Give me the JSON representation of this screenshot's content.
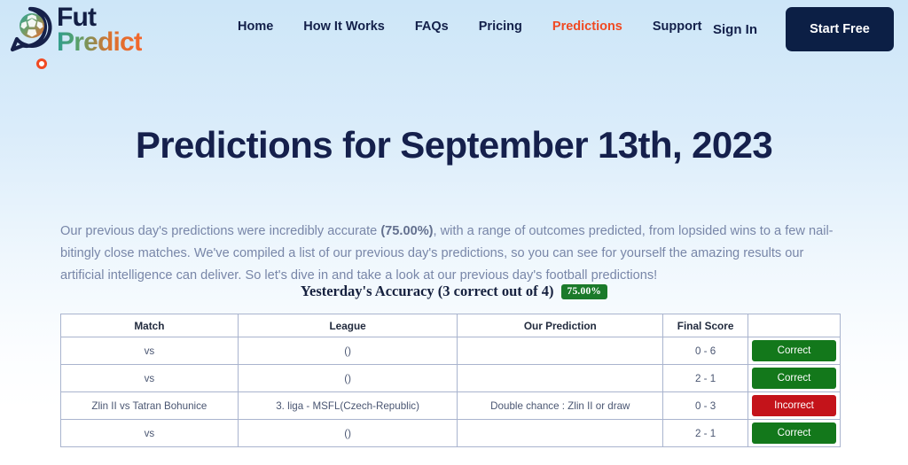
{
  "brand": {
    "name_top": "Fut",
    "name_bottom": "Predict",
    "icon": "soccer-ball-speech-bubble-logo",
    "loader_icon": "loading-ring-icon"
  },
  "nav": {
    "items": [
      {
        "label": "Home",
        "active": false
      },
      {
        "label": "How It Works",
        "active": false
      },
      {
        "label": "FAQs",
        "active": false
      },
      {
        "label": "Pricing",
        "active": false
      },
      {
        "label": "Predictions",
        "active": true
      },
      {
        "label": "Support",
        "active": false
      }
    ],
    "active_color": "#f04a23",
    "default_color": "#13204a"
  },
  "auth": {
    "signin_label": "Sign In",
    "start_free_label": "Start Free",
    "start_free_bg": "#0c1f45"
  },
  "hero": {
    "title": "Predictions for September 13th, 2023"
  },
  "intro": {
    "part1": "Our previous day's predictions were incredibly accurate ",
    "highlight": "(75.00%)",
    "part2": ", with a range of outcomes predicted, from lopsided wins to a few nail-bitingly close matches. We've compiled a list of our previous day's predictions, so you can see for yourself the amazing results our artificial intelligence can deliver. So let's dive in and take a look at our previous day's football predictions!"
  },
  "accuracy": {
    "label": "Yesterday's Accuracy (3 correct out of 4)",
    "badge": "75.00%",
    "badge_color": "#1b7a2a"
  },
  "table": {
    "headers": [
      "Match",
      "League",
      "Our Prediction",
      "Final Score",
      ""
    ],
    "rows": [
      {
        "match": "vs",
        "league": "()",
        "prediction": "",
        "score": "0 - 6",
        "status": "Correct",
        "status_type": "correct"
      },
      {
        "match": "vs",
        "league": "()",
        "prediction": "",
        "score": "2 - 1",
        "status": "Correct",
        "status_type": "correct"
      },
      {
        "match": "Zlin II vs Tatran Bohunice",
        "league": "3. liga - MSFL(Czech-Republic)",
        "prediction": "Double chance : Zlin II or draw",
        "score": "0 - 3",
        "status": "Incorrect",
        "status_type": "incorrect"
      },
      {
        "match": "vs",
        "league": "()",
        "prediction": "",
        "score": "2 - 1",
        "status": "Correct",
        "status_type": "correct"
      }
    ],
    "status_colors": {
      "correct": "#13781b",
      "incorrect": "#c4131a"
    }
  }
}
